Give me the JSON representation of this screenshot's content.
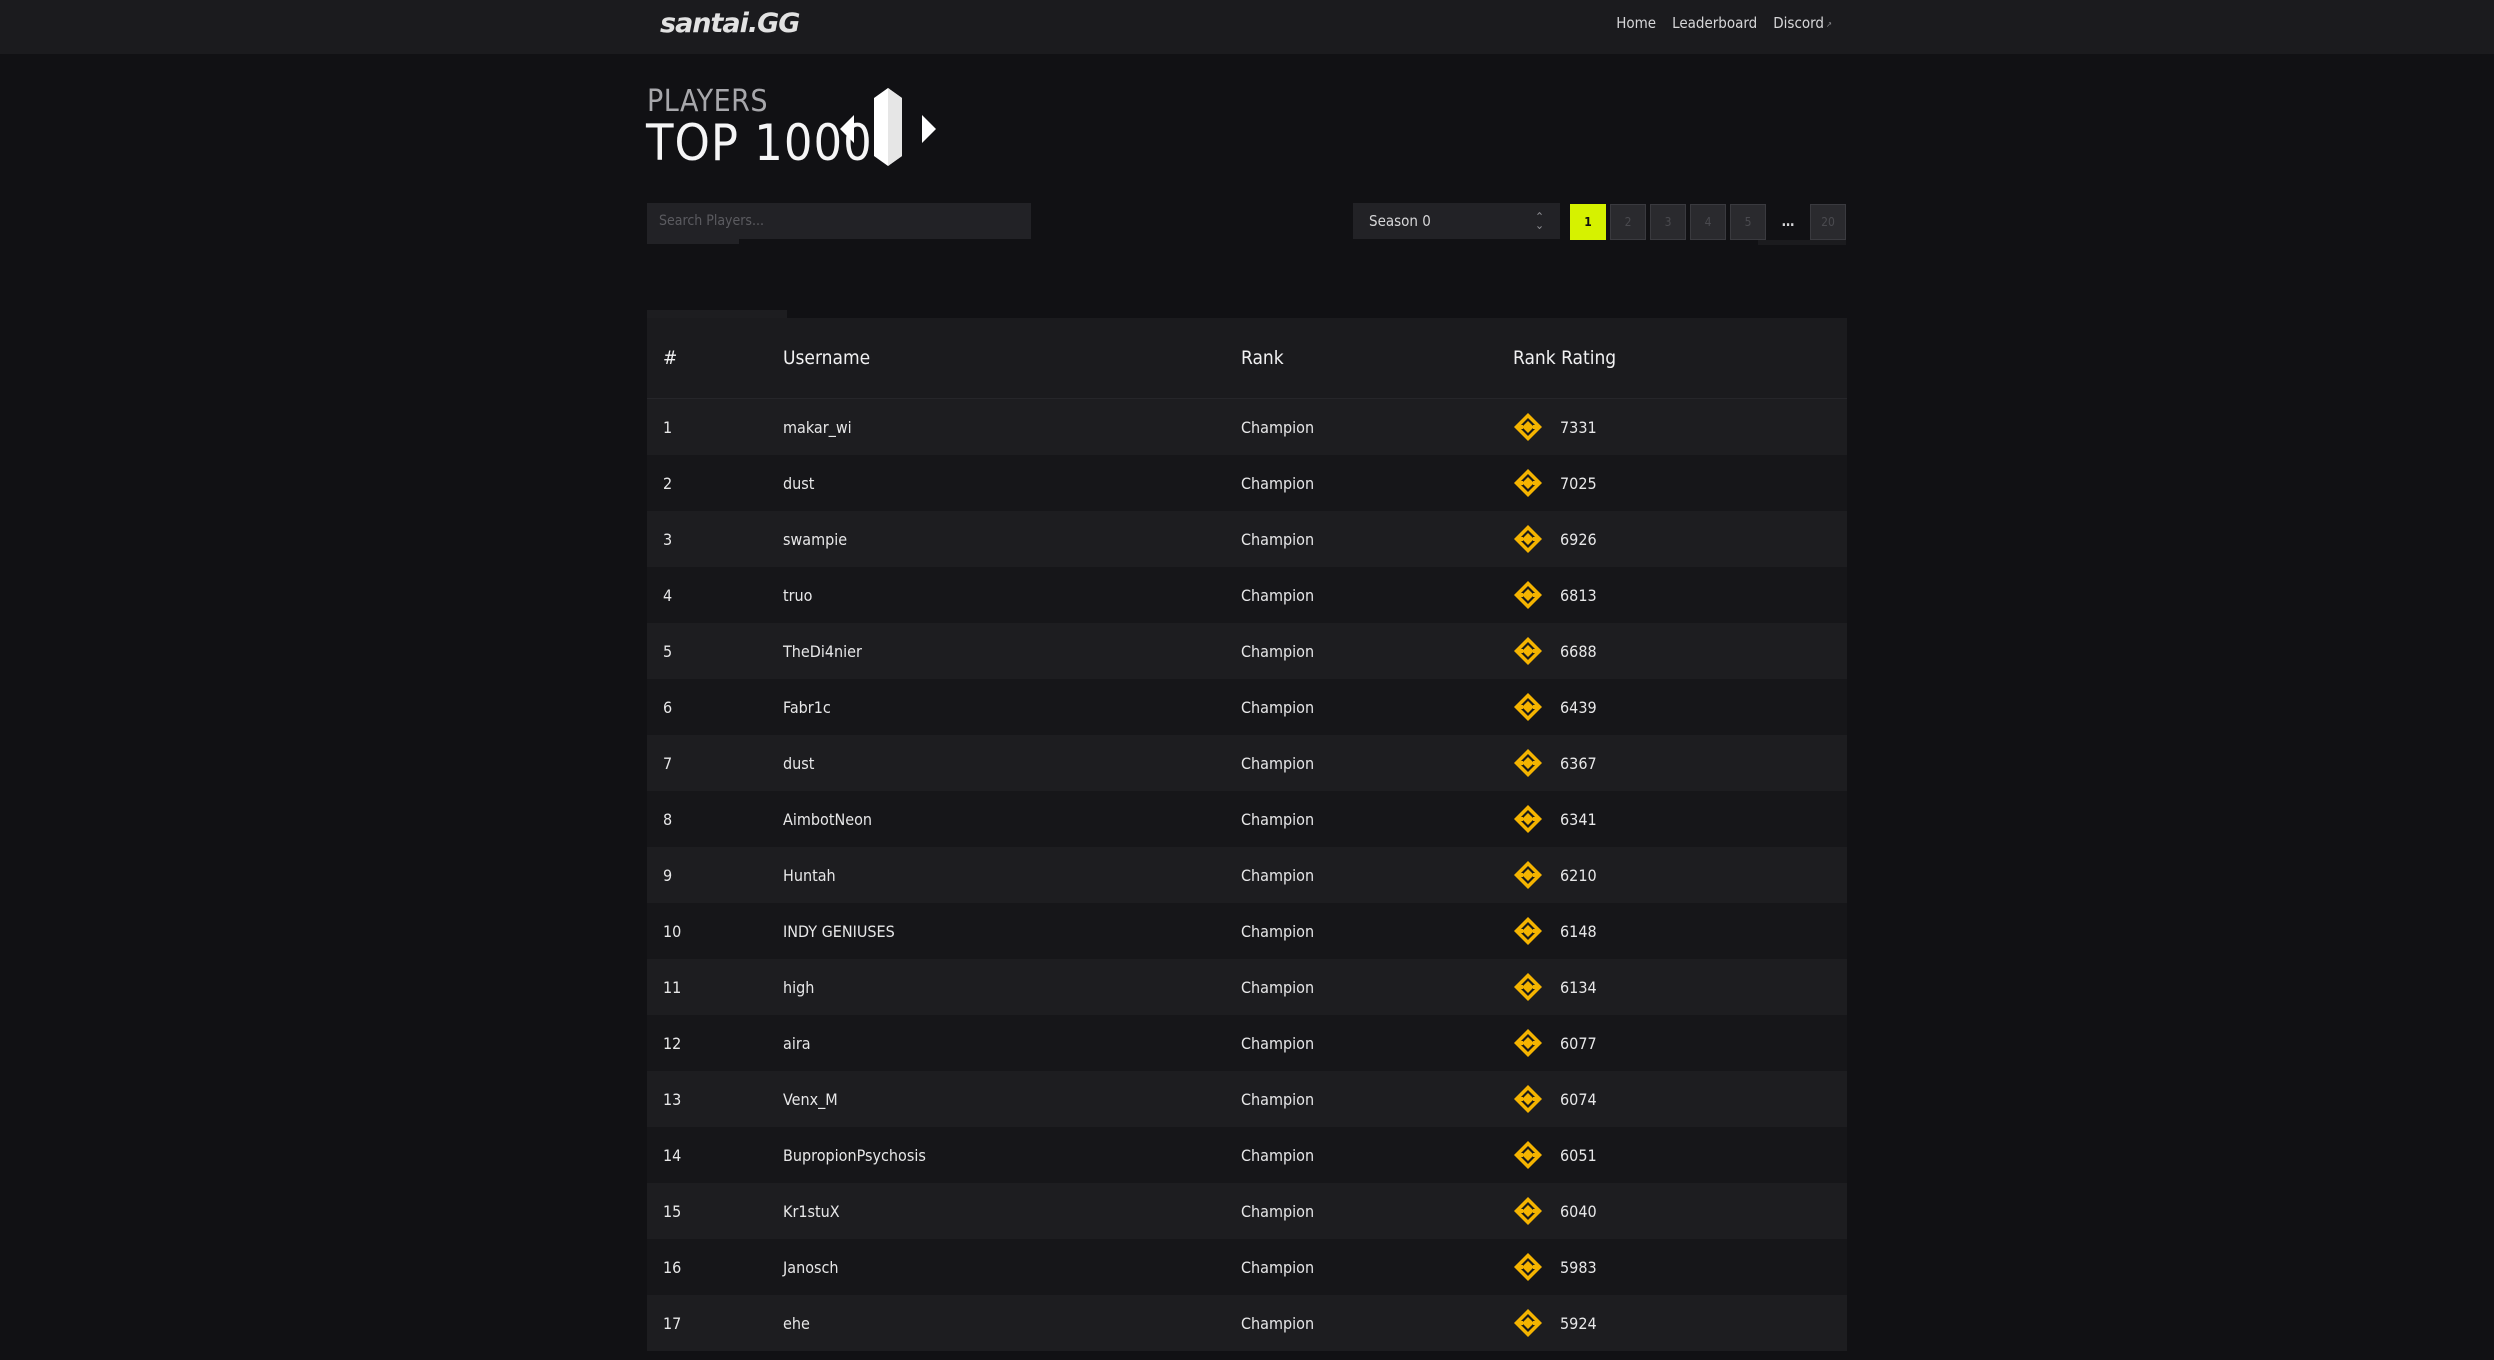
{
  "header": {
    "logo_text": "santai.GG",
    "nav": [
      {
        "label": "Home"
      },
      {
        "label": "Leaderboard"
      },
      {
        "label": "Discord"
      }
    ]
  },
  "hero": {
    "subtitle": "PLAYERS",
    "title": "TOP 1000"
  },
  "search": {
    "placeholder": "Search Players..."
  },
  "season_select": {
    "value": "Season 0"
  },
  "pagination": {
    "pages": [
      "1",
      "2",
      "3",
      "4",
      "5"
    ],
    "active": "1",
    "ellipsis": "…",
    "last": "20"
  },
  "table": {
    "columns": [
      "#",
      "Username",
      "Rank",
      "Rank Rating"
    ],
    "rows": [
      {
        "pos": "1",
        "username": "makar_wi",
        "rank": "Champion",
        "rating": "7331"
      },
      {
        "pos": "2",
        "username": "dust",
        "rank": "Champion",
        "rating": "7025"
      },
      {
        "pos": "3",
        "username": "swampie",
        "rank": "Champion",
        "rating": "6926"
      },
      {
        "pos": "4",
        "username": "truo",
        "rank": "Champion",
        "rating": "6813"
      },
      {
        "pos": "5",
        "username": "TheDi4nier",
        "rank": "Champion",
        "rating": "6688"
      },
      {
        "pos": "6",
        "username": "Fabr1c",
        "rank": "Champion",
        "rating": "6439"
      },
      {
        "pos": "7",
        "username": "dust",
        "rank": "Champion",
        "rating": "6367"
      },
      {
        "pos": "8",
        "username": "AimbotNeon",
        "rank": "Champion",
        "rating": "6341"
      },
      {
        "pos": "9",
        "username": "Huntah",
        "rank": "Champion",
        "rating": "6210"
      },
      {
        "pos": "10",
        "username": "INDY GENIUSES",
        "rank": "Champion",
        "rating": "6148"
      },
      {
        "pos": "11",
        "username": "high",
        "rank": "Champion",
        "rating": "6134"
      },
      {
        "pos": "12",
        "username": "aira",
        "rank": "Champion",
        "rating": "6077"
      },
      {
        "pos": "13",
        "username": "Venx_M",
        "rank": "Champion",
        "rating": "6074"
      },
      {
        "pos": "14",
        "username": "BupropionPsychosis",
        "rank": "Champion",
        "rating": "6051"
      },
      {
        "pos": "15",
        "username": "Kr1stuX",
        "rank": "Champion",
        "rating": "6040"
      },
      {
        "pos": "16",
        "username": "Janosch",
        "rank": "Champion",
        "rating": "5983"
      },
      {
        "pos": "17",
        "username": "ehe",
        "rank": "Champion",
        "rating": "5924"
      }
    ],
    "rank_icon": "champion-rank-icon"
  },
  "colors": {
    "accent": "#d6f200",
    "rank_icon": "#f5b400",
    "background": "#111114"
  }
}
